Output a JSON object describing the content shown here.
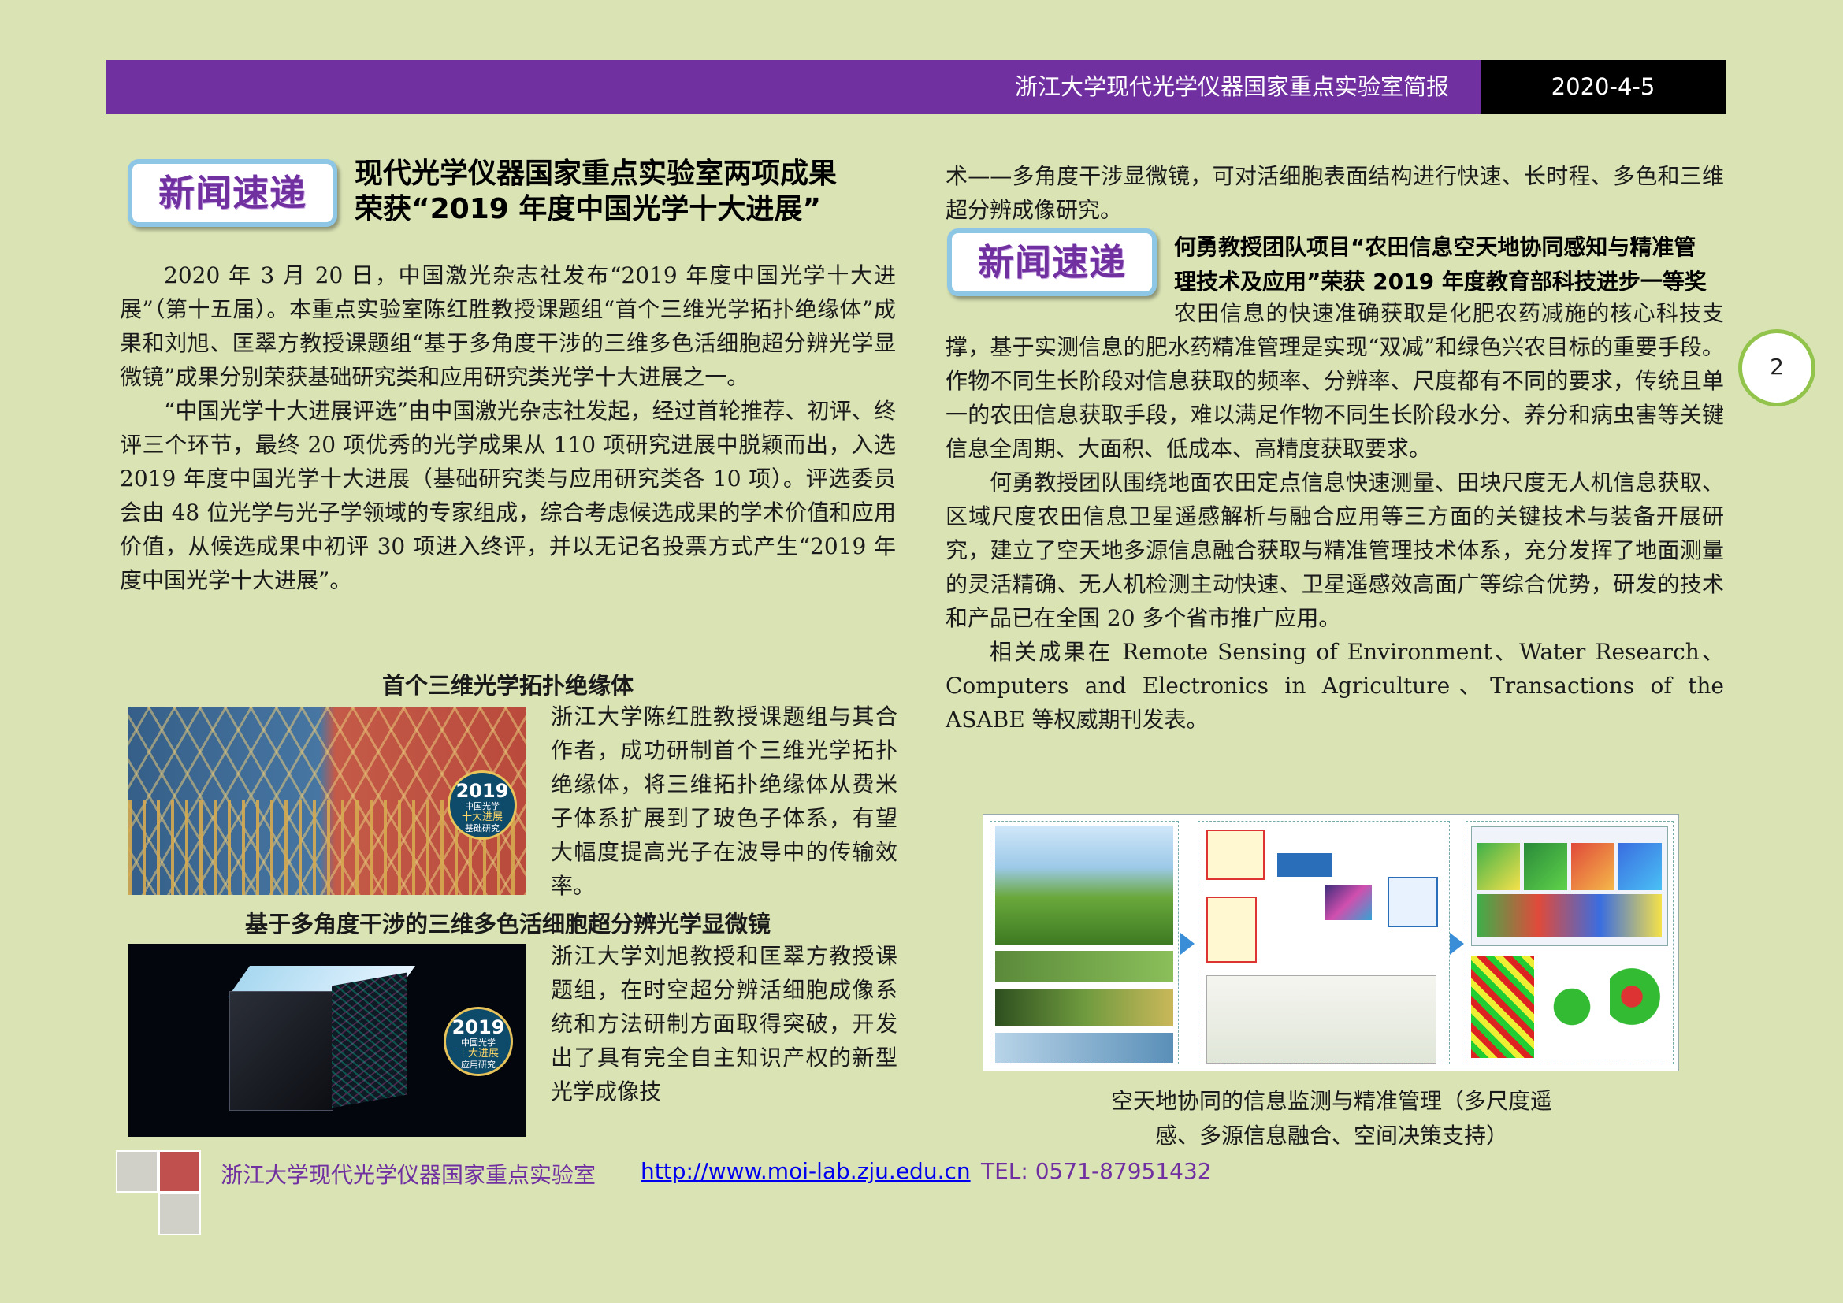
{
  "header": {
    "title": "浙江大学现代光学仪器国家重点实验室简报",
    "date": "2020-4-5"
  },
  "page_number": "2",
  "badge_label": "新闻速递",
  "article1": {
    "title_line1": "现代光学仪器国家重点实验室两项成果",
    "title_line2": "荣获“2019 年度中国光学十大进展”",
    "para1": "2020 年 3 月 20 日，中国激光杂志社发布“2019 年度中国光学十大进展”（第十五届）。本重点实验室陈红胜教授课题组“首个三维光学拓扑绝缘体”成果和刘旭、匡翠方教授课题组“基于多角度干涉的三维多色活细胞超分辨光学显微镜”成果分别荣获基础研究类和应用研究类光学十大进展之一。",
    "para2": "“中国光学十大进展评选”由中国激光杂志社发起，经过首轮推荐、初评、终评三个环节，最终 20 项优秀的光学成果从 110 项研究进展中脱颖而出，入选 2019 年度中国光学十大进展（基础研究类与应用研究类各 10 项）。评选委员会由 48 位光学与光子学领域的专家组成，综合考虑候选成果的学术价值和应用价值，从候选成果中初评 30 项进入终评，并以无记名投票方式产生“2019 年度中国光学十大进展”。",
    "sub1_title": "首个三维光学拓扑绝缘体",
    "sub1_text": "浙江大学陈红胜教授课题组与其合作者，成功研制首个三维光学拓扑绝缘体，将三维拓扑绝缘体从费米子体系扩展到了玻色子体系，有望大幅度提高光子在波导中的传输效率。",
    "sub2_title": "基于多角度干涉的三维多色活细胞超分辨光学显微镜",
    "sub2_text": "浙江大学刘旭教授和匡翠方教授课题组，在时空超分辨活细胞成像系统和方法研制方面取得突破，开发出了具有完全自主知识产权的新型光学成像技",
    "continued_text": "术——多角度干涉显微镜，可对活细胞表面结构进行快速、长时程、多色和三维超分辨成像研究。",
    "seal1": {
      "year": "2019",
      "line1": "中国光学",
      "line2": "十大进展",
      "line3": "基础研究"
    },
    "seal2": {
      "year": "2019",
      "line1": "中国光学",
      "line2": "十大进展",
      "line3": "应用研究"
    }
  },
  "article2": {
    "title_line1": "何勇教授团队项目“农田信息空天地协同感知与精准管",
    "title_line2": "理技术及应用”荣获 2019 年度教育部科技进步一等奖",
    "para1": "农田信息的快速准确获取是化肥农药减施的核心科技支撑，基于实测信息的肥水药精准管理是实现“双减”和绿色兴农目标的重要手段。作物不同生长阶段对信息获取的频率、分辨率、尺度都有不同的要求，传统且单一的农田信息获取手段，难以满足作物不同生长阶段水分、养分和病虫害等关键信息全周期、大面积、低成本、高精度获取要求。",
    "para2": "何勇教授团队围绕地面农田定点信息快速测量、田块尺度无人机信息获取、区域尺度农田信息卫星遥感解析与融合应用等三方面的关键技术与装备开展研究，建立了空天地多源信息融合获取与精准管理技术体系，充分发挥了地面测量的灵活精确、无人机检测主动快速、卫星遥感效高面广等综合优势，研发的技术和产品已在全国 20 多个省市推广应用。",
    "para3": "相关成果在 Remote Sensing of Environment、Water Research、Computers and Electronics in Agriculture、Transactions of the ASABE 等权威期刊发表。",
    "caption_line1": "空天地协同的信息监测与精准管理（多尺度遥",
    "caption_line2": "感、多源信息融合、空间决策支持）"
  },
  "footer": {
    "org": "浙江大学现代光学仪器国家重点实验室",
    "url": "http://www.moi-lab.zju.edu.cn",
    "tel": "TEL: 0571-87951432"
  },
  "colors": {
    "background": "#d9e3b4",
    "header": "#7030a0",
    "badge_border": "#8ec7e6",
    "accent_green": "#92c34b"
  }
}
